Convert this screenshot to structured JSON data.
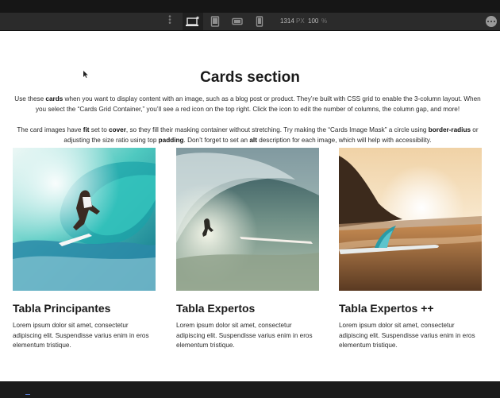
{
  "toolbar": {
    "width_value": "1314",
    "width_unit": "PX",
    "zoom_value": "100",
    "zoom_unit": "%"
  },
  "page": {
    "title": "Cards section",
    "desc1": {
      "t1": "Use these ",
      "b1": "cards",
      "t2": " when you want to display content with an image, such as a blog post or product. They’re built with CSS grid to enable the 3-column layout. When you select the “Cards Grid Container,” you’ll see a red icon on the top right. Click the icon to edit the number of columns, the column gap, and more!"
    },
    "desc2": {
      "t1": "The card images have ",
      "b1": "fit",
      "t2": " set to ",
      "b2": "cover",
      "t3": ", so they fill their masking container without stretching. Try making the “Cards Image Mask” a circle using ",
      "b3": "border-radius",
      "t4": " or adjusting the size ratio using top ",
      "b4": "padding",
      "t5": ". Don’t forget to set an ",
      "b5": "alt",
      "t6": " description for each image, which will help with accessibility."
    },
    "cards": [
      {
        "title": "Tabla Principantes",
        "text": "Lorem ipsum dolor sit amet, consectetur adipiscing elit. Suspendisse varius enim in eros elementum tristique."
      },
      {
        "title": "Tabla Expertos",
        "text": "Lorem ipsum dolor sit amet, consectetur adipiscing elit. Suspendisse varius enim in eros elementum tristique."
      },
      {
        "title": "Tabla Expertos ++",
        "text": "Lorem ipsum dolor sit amet, consectetur adipiscing elit. Suspendisse varius enim in eros elementum tristique."
      }
    ]
  },
  "icons": {
    "toolbar_more": "ellipsis-icon",
    "desktop": "desktop-star-icon",
    "tablet": "tablet-icon",
    "landscape": "mobile-landscape-icon",
    "portrait": "mobile-portrait-icon"
  },
  "colors": {
    "toolbar_bg": "#2b2b2b",
    "canvas_bg": "#ffffff",
    "accent": "#5a7ed8"
  }
}
